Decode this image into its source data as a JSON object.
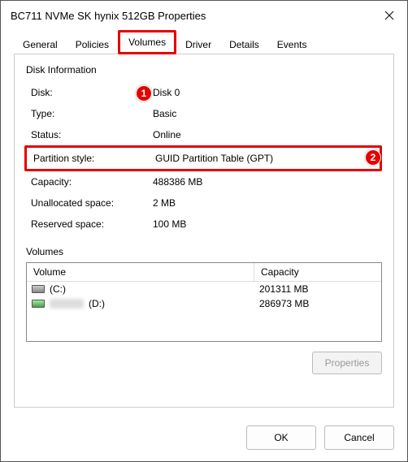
{
  "window": {
    "title": "BC711 NVMe SK hynix 512GB Properties"
  },
  "tabs": {
    "general": "General",
    "policies": "Policies",
    "volumes": "Volumes",
    "driver": "Driver",
    "details": "Details",
    "events": "Events",
    "active": "volumes"
  },
  "annotations": {
    "badge1": "1",
    "badge2": "2"
  },
  "diskInfo": {
    "heading": "Disk Information",
    "rows": {
      "disk": {
        "k": "Disk:",
        "v": "Disk 0"
      },
      "type": {
        "k": "Type:",
        "v": "Basic"
      },
      "status": {
        "k": "Status:",
        "v": "Online"
      },
      "pstyle": {
        "k": "Partition style:",
        "v": "GUID Partition Table (GPT)"
      },
      "capacity": {
        "k": "Capacity:",
        "v": "488386 MB"
      },
      "unalloc": {
        "k": "Unallocated space:",
        "v": "2 MB"
      },
      "reserved": {
        "k": "Reserved space:",
        "v": "100 MB"
      }
    }
  },
  "volumes": {
    "heading": "Volumes",
    "columns": {
      "name": "Volume",
      "capacity": "Capacity"
    },
    "items": [
      {
        "label": "(C:)",
        "capacity": "201311 MB",
        "blurred": false
      },
      {
        "label": "(D:)",
        "capacity": "286973 MB",
        "blurred": true
      }
    ]
  },
  "buttons": {
    "properties": "Properties",
    "ok": "OK",
    "cancel": "Cancel"
  }
}
